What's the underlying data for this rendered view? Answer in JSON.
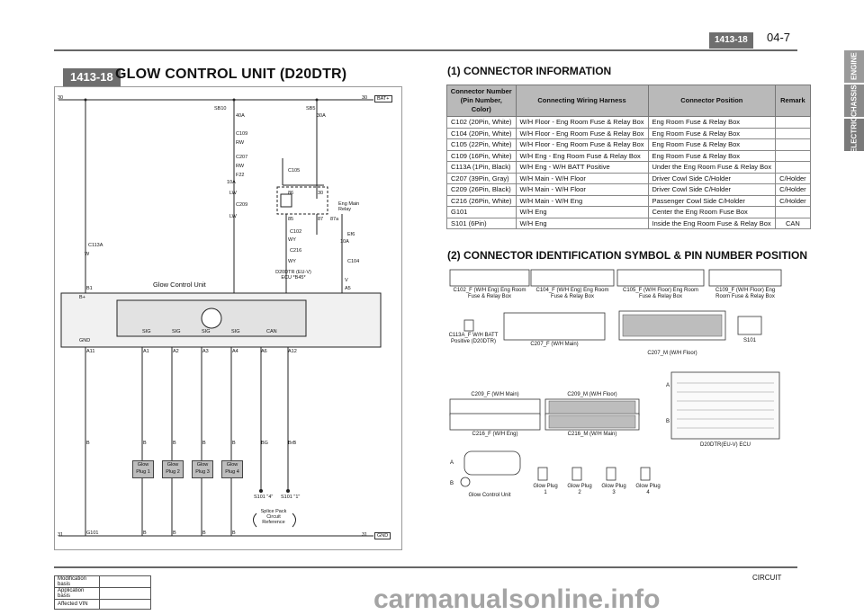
{
  "header": {
    "code_badge": "1413-18",
    "page": "04-7"
  },
  "side_tabs": [
    "ENGINE",
    "CHASSIS",
    "ELECTRIC"
  ],
  "left": {
    "badge": "1413-18",
    "title": "GLOW CONTROL UNIT (D20DTR)",
    "wiring": {
      "rail_top_left": "30",
      "rail_top_right": "30",
      "bat": "BAT+",
      "rail_bot_left": "31",
      "rail_bot_right": "31",
      "gnd": "GND",
      "sb10": "SB10",
      "sb10_amp": "40A",
      "c109": "C109",
      "rw1": "RW",
      "c207": "C207",
      "rw2": "RW",
      "f22": "F22",
      "f22_amp": "10A",
      "lw1": "LW",
      "c209": "C209",
      "lw2": "LW",
      "sb5": "SB5",
      "sb5_amp": "30A",
      "c105": "C105",
      "relay_86": "86",
      "relay_30": "30",
      "relay_85": "85",
      "relay_87": "87",
      "relay_87a": "87a",
      "relay_name": "Eng Main Relay",
      "c102": "C102",
      "wy1": "WY",
      "c216": "C216",
      "wy2": "WY",
      "ef6": "Ef6",
      "ef6_amp": "10A",
      "c104": "C104",
      "v": "V",
      "ecu": "D20DTR (EU-V) ECU *B45*",
      "c113a": "C113A",
      "w": "W",
      "b1": "B1",
      "a5": "A5",
      "bplus": "B+",
      "gcu": "Glow Control Unit",
      "pins": [
        "GND",
        "SIG",
        "SIG",
        "SIG",
        "SIG",
        "CAN"
      ],
      "pin_ids": [
        "A11",
        "A1",
        "A2",
        "A3",
        "A4",
        "A6",
        "A12"
      ],
      "wires": [
        "B",
        "B",
        "B",
        "B",
        "B",
        "BG",
        "BrB"
      ],
      "glow": [
        "Glow Plug 1",
        "Glow Plug 2",
        "Glow Plug 3",
        "Glow Plug 4"
      ],
      "s101a": "S101 \"4\"",
      "s101b": "S101 \"1\"",
      "splice": "Splice Pack Circuit Reference",
      "g101": "G101",
      "bot_b": [
        "B",
        "B",
        "B",
        "B"
      ]
    }
  },
  "connector_info": {
    "heading": "(1) CONNECTOR INFORMATION",
    "columns": [
      "Connector Number (Pin Number, Color)",
      "Connecting Wiring Harness",
      "Connector Position",
      "Remark"
    ],
    "rows": [
      [
        "C102 (20Pin, White)",
        "W/H Floor - Eng Room Fuse & Relay Box",
        "Eng Room Fuse & Relay Box",
        ""
      ],
      [
        "C104 (20Pin, White)",
        "W/H Floor - Eng Room Fuse & Relay Box",
        "Eng Room Fuse & Relay Box",
        ""
      ],
      [
        "C105 (22Pin, White)",
        "W/H Floor - Eng Room Fuse & Relay Box",
        "Eng Room Fuse & Relay Box",
        ""
      ],
      [
        "C109 (16Pin, White)",
        "W/H Eng - Eng Room Fuse & Relay Box",
        "Eng Room Fuse & Relay Box",
        ""
      ],
      [
        "C113A (1Pin, Black)",
        "W/H Eng - W/H BATT Positive",
        "Under the Eng Room Fuse & Relay Box",
        ""
      ],
      [
        "C207 (39Pin, Gray)",
        "W/H Main - W/H Floor",
        "Driver Cowl Side C/Holder",
        "C/Holder"
      ],
      [
        "C209 (26Pin, Black)",
        "W/H Main - W/H Floor",
        "Driver Cowl Side C/Holder",
        "C/Holder"
      ],
      [
        "C216 (26Pin, White)",
        "W/H Main - W/H Eng",
        "Passenger Cowl Side C/Holder",
        "C/Holder"
      ],
      [
        "G101",
        "W/H Eng",
        "Center the Eng Room Fuse Box",
        ""
      ],
      [
        "S101 (6Pin)",
        "W/H Eng",
        "Inside the Eng Room Fuse & Relay Box",
        "CAN"
      ]
    ]
  },
  "connector_symbols": {
    "heading": "(2) CONNECTOR IDENTIFICATION SYMBOL & PIN NUMBER POSITION",
    "captions": {
      "c102": "C102_F (W/H Eng) Eng Room Fuse & Relay Box",
      "c104": "C104_F (W/H Eng) Eng Room Fuse & Relay Box",
      "c105": "C105_F (W/H Floor) Eng Room Fuse & Relay Box",
      "c109": "C109_F (W/H Floor) Eng Room Fuse & Relay Box",
      "c113a": "C113A_F W/H BATT Positive (D20DTR)",
      "c207f": "C207_F (W/H Main)",
      "c207m": "C207_M (W/H Floor)",
      "s101": "S101",
      "c209f": "C209_F (W/H Main)",
      "c209m": "C209_M (W/H Floor)",
      "c216f": "C216_F (W/H Eng)",
      "c216m": "C216_M (W/H Main)",
      "ecu": "D20DTR(EU-V) ECU",
      "gcu": "Glow Control Unit",
      "glow": [
        "Glow Plug 1",
        "Glow Plug 2",
        "Glow Plug 3",
        "Glow Plug 4"
      ],
      "label_a": "A",
      "label_b": "B"
    }
  },
  "footer": {
    "rows": [
      "Modification basis",
      "Application basis",
      "Affected VIN"
    ],
    "circuit": "CIRCUIT",
    "watermark": "carmanualsonline.info"
  },
  "colors": {
    "badge_gray": "#6e6e6e",
    "tab_engine": "#9a9a9a",
    "tab_chassis": "#8a8a8a",
    "tab_electric": "#7a7a7a",
    "table_header": "#b9b9b9"
  }
}
